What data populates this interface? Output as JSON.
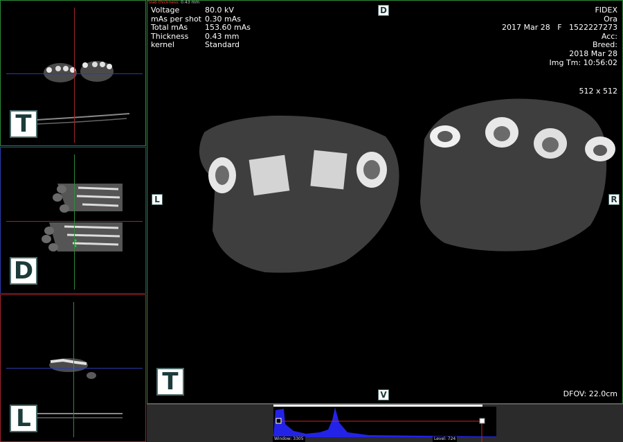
{
  "slab": {
    "label": "Slab thickness:",
    "value": "0.43 mm"
  },
  "scan_params": [
    {
      "key": "Voltage",
      "value": "80.0 kV"
    },
    {
      "key": "mAs per shot",
      "value": "0.30 mAs"
    },
    {
      "key": "Total mAs",
      "value": "153.60 mAs"
    },
    {
      "key": "Thickness",
      "value": "0.43 mm"
    },
    {
      "key": "kernel",
      "value": "Standard"
    }
  ],
  "patient": {
    "institution": "FIDEX",
    "name": "Ora",
    "study_line": "2017 Mar 28   F   1522227273",
    "acc": "Acc:",
    "breed": "Breed:",
    "date": "2018 Mar 28",
    "img_time": "Img Tm: 10:56:02"
  },
  "matrix": "512 x 512",
  "dfov": "DFOV: 22.0cm",
  "orientation": {
    "small_axial": "T",
    "small_dorsal": "D",
    "small_lateral": "L",
    "main_view": "T",
    "main_top": "D",
    "main_bottom": "V",
    "main_left": "L",
    "main_right": "R"
  },
  "histogram": {
    "window_label": "Window: 3305",
    "level_label": "Level: 724"
  },
  "colors": {
    "axial": "#2e8b3a",
    "dorsal": "#2a3db0",
    "lateral": "#a2232f",
    "histogram_fill": "#2323e8",
    "window_line": "#cc2222"
  }
}
